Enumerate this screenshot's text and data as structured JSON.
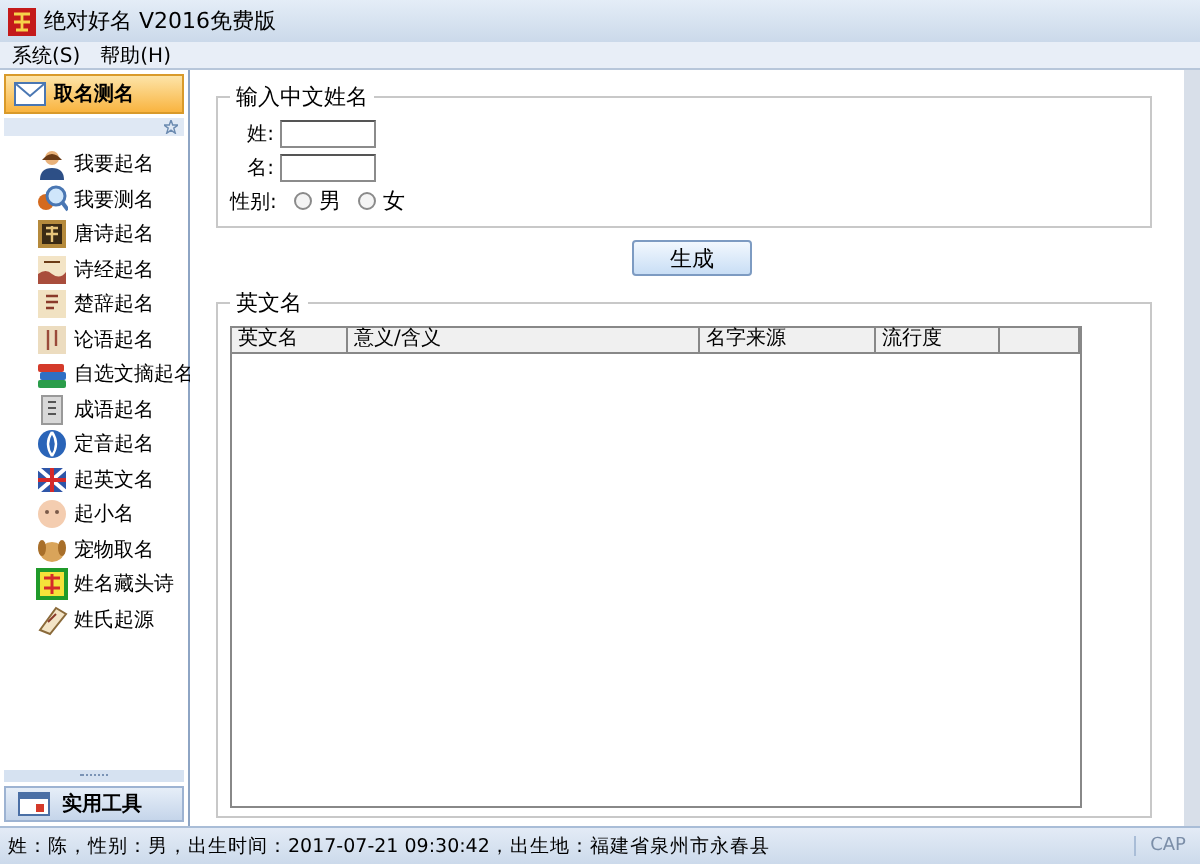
{
  "window": {
    "title": "绝对好名 V2016免费版"
  },
  "menu": [
    "系统(S)",
    "帮助(H)"
  ],
  "sidebar": {
    "header": "取名测名",
    "items": [
      {
        "label": "我要起名"
      },
      {
        "label": "我要测名"
      },
      {
        "label": "唐诗起名"
      },
      {
        "label": "诗经起名"
      },
      {
        "label": "楚辞起名"
      },
      {
        "label": "论语起名"
      },
      {
        "label": "自选文摘起名"
      },
      {
        "label": "成语起名"
      },
      {
        "label": "定音起名"
      },
      {
        "label": "起英文名"
      },
      {
        "label": "起小名"
      },
      {
        "label": "宠物取名"
      },
      {
        "label": "姓名藏头诗"
      },
      {
        "label": "姓氏起源"
      }
    ],
    "footer": "实用工具"
  },
  "chinese_name": {
    "title": "输入中文姓名",
    "surname_label": "姓:",
    "given_label": "名:",
    "gender_label": "性别:",
    "genders": [
      {
        "label": "男",
        "selected": false
      },
      {
        "label": "女",
        "selected": false
      }
    ]
  },
  "generate_button": "生成",
  "english_name": {
    "title": "英文名",
    "columns": [
      "英文名",
      "意义/含义",
      "名字来源",
      "流行度"
    ]
  },
  "status_bar": {
    "text": "姓：陈，性别：男，出生时间：2017-07-21 09:30:42，出生地：福建省泉州市永春县",
    "cap": "CAP"
  }
}
